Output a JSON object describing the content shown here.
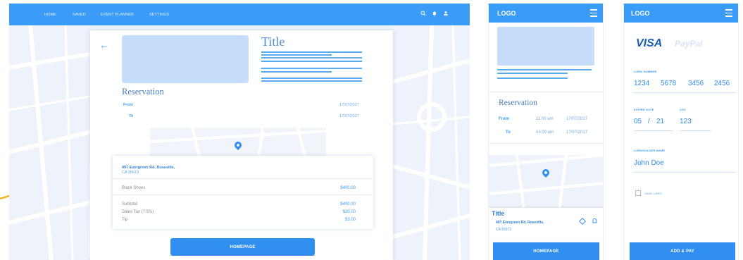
{
  "desktop": {
    "nav": [
      "HOME",
      "SAVED",
      "EVENT PLANNER",
      "SETTINGS"
    ],
    "nav_icons": [
      "search-icon",
      "bell-icon",
      "user-icon"
    ],
    "title": "Title",
    "reservation": "Reservation",
    "from_label": "From",
    "to_label": "To",
    "from_date": "17/07/2017",
    "to_date": "17/07/2017",
    "address_line1": "497 Evergreen Rd. Roseville,",
    "address_line2": "CA 95673",
    "item": "Black Shoes",
    "item_price": "$400.00",
    "subtotal_label": "Subtotal",
    "subtotal": "$400.00",
    "tax_label": "Sales Tax (7.5%)",
    "tax": "$20.00",
    "tip_label": "Tip",
    "tip": "$3.00",
    "button": "HOMEPAGE"
  },
  "mobile1": {
    "logo": "LOGO",
    "reservation": "Reservation",
    "from_label": "From",
    "to_label": "To",
    "from_time": "11.00 am",
    "to_time": "13.00 am",
    "from_date": "17/07/2017",
    "to_date": "17/07/2017",
    "card_title": "Title",
    "address_line1": "497 Evergreen Rd. Roseville,",
    "address_line2": "CA 95673",
    "button": "HOMEPAGE"
  },
  "mobile2": {
    "logo": "LOGO",
    "visa": "VISA",
    "paypal": "PayPal",
    "card_number_label": "CARD NUMBER",
    "card_number": [
      "1234",
      "5678",
      "3456",
      "2456"
    ],
    "expire_label": "EXPIRE DATE",
    "expire_month": "05",
    "expire_sep": "/",
    "expire_year": "21",
    "cvv_label": "CVV",
    "cvv": "123",
    "holder_label": "CARDHOLDER NAME",
    "holder": "John Doe",
    "save_card": "SAVE CARD",
    "button": "ADD & PAY"
  },
  "colors": {
    "primary": "#3a9cf6",
    "placeholder": "#c6defa",
    "arrow": "#f5b323"
  }
}
